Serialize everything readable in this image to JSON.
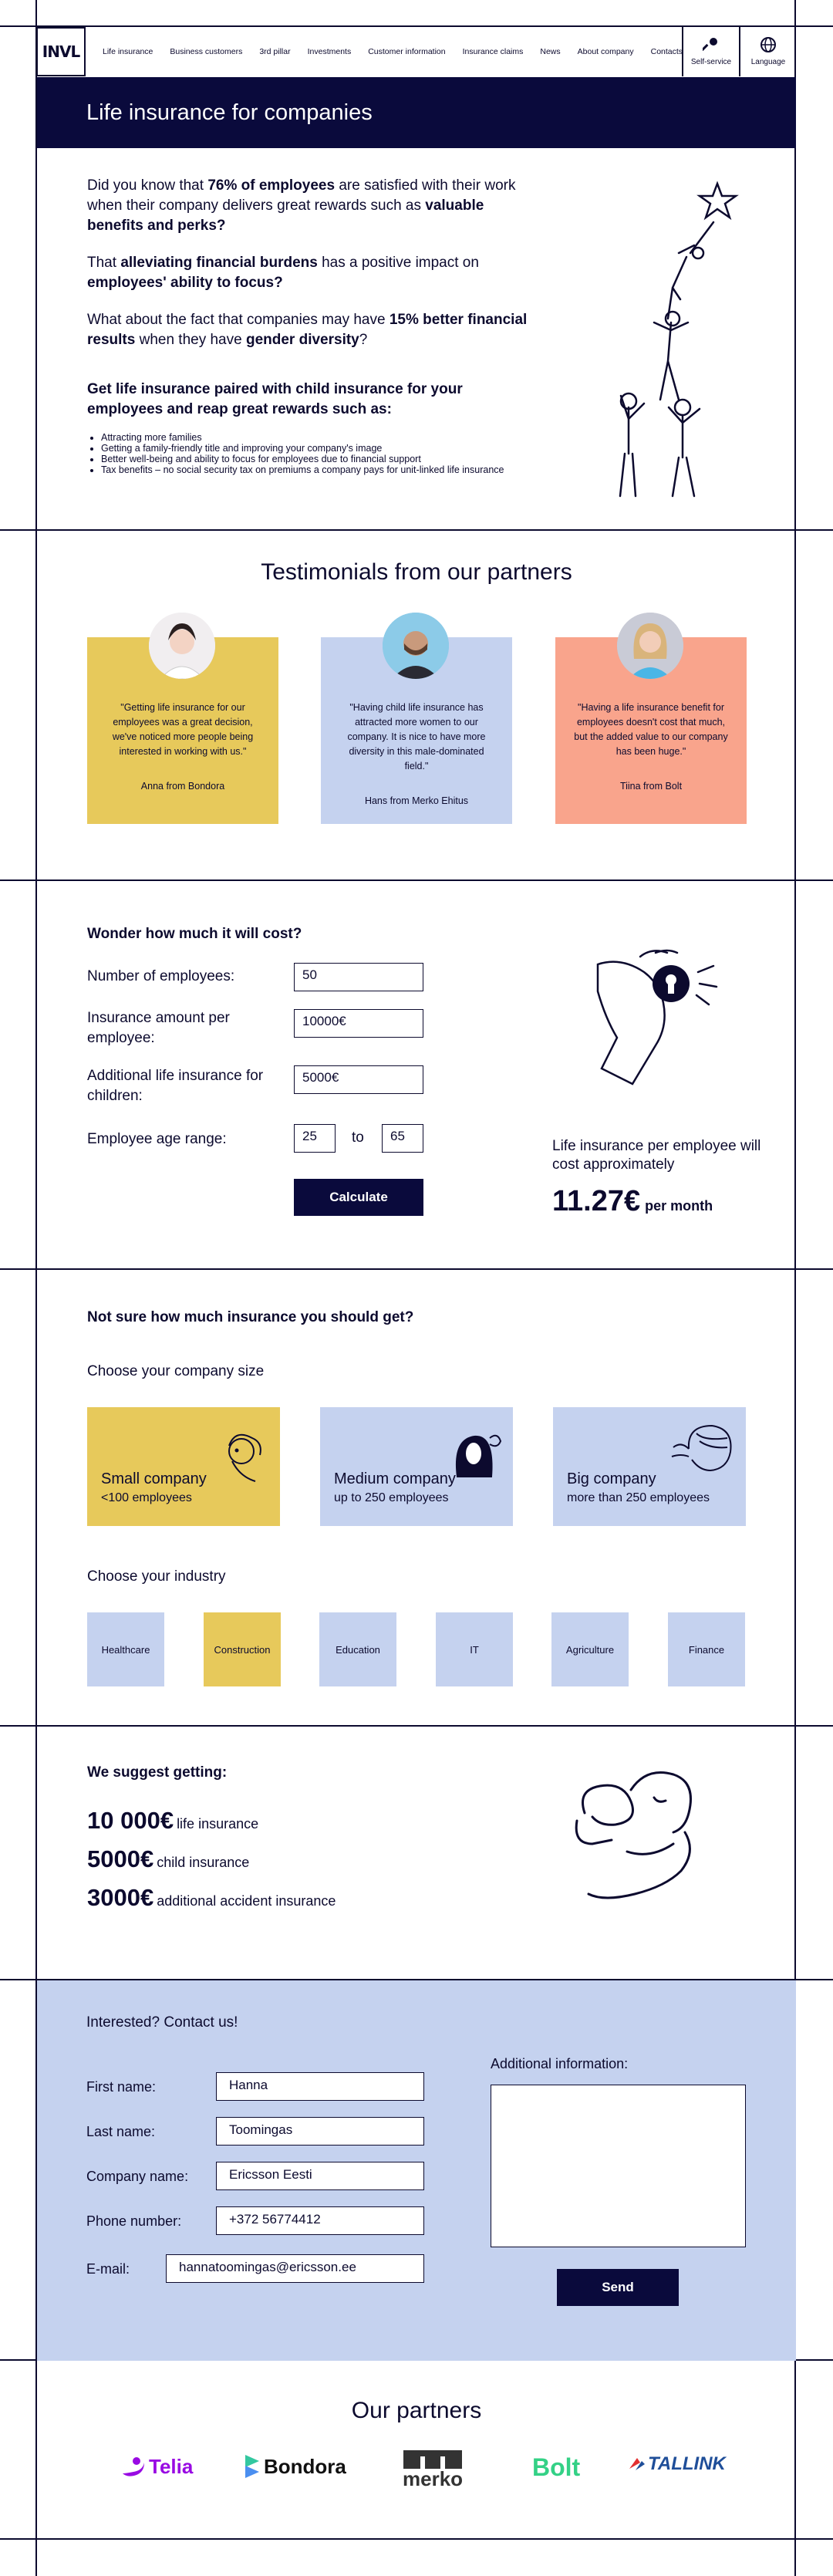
{
  "header": {
    "logo_text": "INVL",
    "nav": [
      "Life insurance",
      "Business customers",
      "3rd pillar",
      "Investments",
      "Customer information",
      "Insurance claims",
      "News",
      "About company",
      "Contacts"
    ],
    "self_service": "Self-service",
    "language": "Language"
  },
  "hero": {
    "title": "Life insurance for companies"
  },
  "intro": {
    "p1_pre": "Did you know that ",
    "p1_bold1": "76% of employees",
    "p1_mid": " are satisfied with their work when their company delivers great rewards such as ",
    "p1_bold2": "valuable benefits and perks?",
    "p2_pre": "That ",
    "p2_bold1": "alleviating financial burdens",
    "p2_mid": " has a positive impact on ",
    "p2_bold2": "employees' ability to focus?",
    "p3_pre": "What about the fact that companies may have ",
    "p3_bold1": "15% better financial results",
    "p3_mid": " when they have ",
    "p3_bold2": "gender diversity",
    "p3_end": "?",
    "heading": "Get life insurance paired with child insurance for your employees and reap great rewards such as:",
    "bullets": [
      "Attracting more families",
      "Getting a family-friendly title and improving your company's image",
      "Better well-being and ability to focus for employees due to financial support",
      "Tax benefits – no social security tax on premiums a company pays for unit-linked life insurance"
    ]
  },
  "testimonials": {
    "title": "Testimonials from our partners",
    "items": [
      {
        "quote": "\"Getting life insurance for our employees was a great decision, we've noticed more people being interested in working with us.\"",
        "author": "Anna from Bondora",
        "color": "#e7c95b"
      },
      {
        "quote": "\"Having child life insurance has attracted more women to our company. It is nice to have more diversity in this male-dominated field.\"",
        "author": "Hans from Merko Ehitus",
        "color": "#c5d2ef"
      },
      {
        "quote": "\"Having a life insurance benefit for employees doesn't cost that much, but the added value to our company has been huge.\"",
        "author": "Tiina from Bolt",
        "color": "#f9a48c"
      }
    ]
  },
  "calculator": {
    "title": "Wonder how much it will cost?",
    "employees_label": "Number of employees:",
    "employees_value": "50",
    "amount_label": "Insurance amount per employee:",
    "amount_value": "10000€",
    "child_label": "Additional life insurance for children:",
    "child_value": "5000€",
    "age_label": "Employee age range:",
    "age_min": "25",
    "age_to": "to",
    "age_max": "65",
    "button": "Calculate",
    "result_text": "Life insurance per employee will cost approximately",
    "result_value": "11.27€",
    "result_unit": "per month"
  },
  "chooser": {
    "title": "Not sure how much insurance you should get?",
    "size_title": "Choose your company size",
    "sizes": [
      {
        "name": "Small company",
        "desc": "<100 employees"
      },
      {
        "name": "Medium company",
        "desc": "up to 250 employees"
      },
      {
        "name": "Big company",
        "desc": "more than 250 employees"
      }
    ],
    "industry_title": "Choose your industry",
    "industries": [
      "Healthcare",
      "Construction",
      "Education",
      "IT",
      "Agriculture",
      "Finance"
    ]
  },
  "suggestion": {
    "title": "We suggest getting:",
    "items": [
      {
        "value": "10 000€",
        "label": "life insurance"
      },
      {
        "value": "5000€",
        "label": "child insurance"
      },
      {
        "value": "3000€",
        "label": "additional accident insurance"
      }
    ]
  },
  "contact": {
    "title": "Interested? Contact us!",
    "first_name_label": "First name:",
    "first_name": "Hanna",
    "last_name_label": "Last name:",
    "last_name": "Toomingas",
    "company_label": "Company name:",
    "company": "Ericsson Eesti",
    "phone_label": "Phone number:",
    "phone": "+372 56774412",
    "email_label": "E-mail:",
    "email": "hannatoomingas@ericsson.ee",
    "additional_label": "Additional information:",
    "send": "Send"
  },
  "partners": {
    "title": "Our partners",
    "logos": [
      "Telia",
      "Bondora",
      "merko",
      "Bolt",
      "TALLINK"
    ]
  }
}
